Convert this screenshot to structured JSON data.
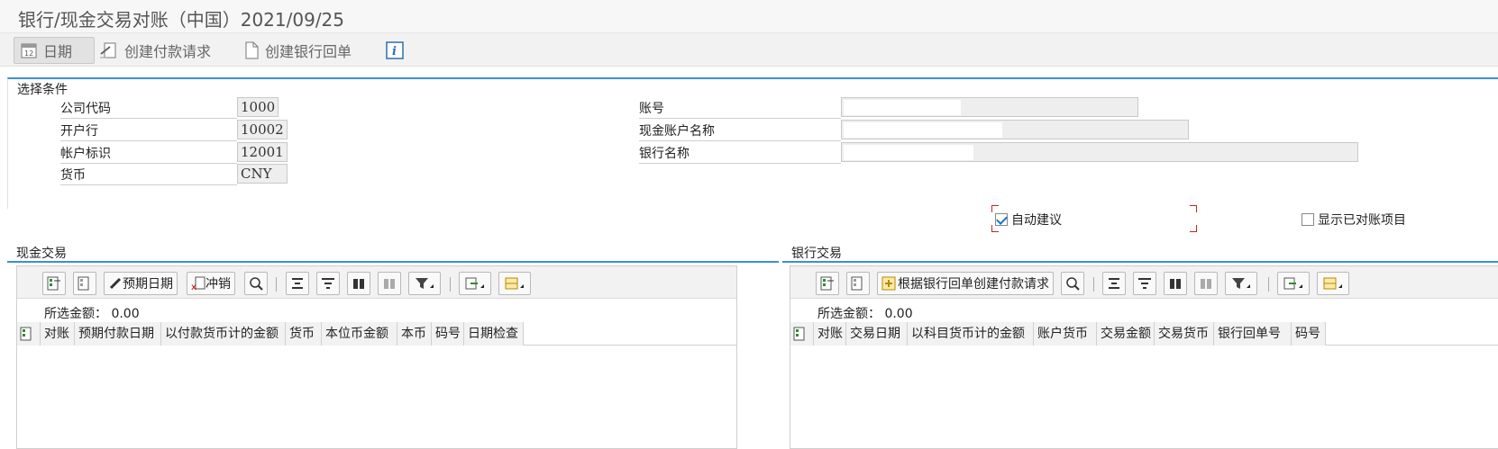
{
  "title": "银行/现金交易对账（中国）2021/09/25",
  "toolbar": {
    "date": "日期",
    "create_payment": "创建付款请求",
    "create_bank_receipt": "创建银行回单",
    "info": "i"
  },
  "selection": {
    "title": "选择条件",
    "left": [
      {
        "label": "公司代码",
        "value": "1000"
      },
      {
        "label": "开户行",
        "value": "10002"
      },
      {
        "label": "帐户标识",
        "value": "12001"
      },
      {
        "label": "货币",
        "value": "CNY"
      }
    ],
    "right": [
      {
        "label": "账号"
      },
      {
        "label": "现金账户名称"
      },
      {
        "label": "银行名称"
      }
    ]
  },
  "options": {
    "auto_suggest": {
      "label": "自动建议",
      "checked": true
    },
    "show_reconciled": {
      "label": "显示已对账项目",
      "checked": false
    }
  },
  "cash": {
    "title": "现金交易",
    "btn_expected_date": "预期日期",
    "btn_reverse": "冲销",
    "selected_amount_label": "所选金额：",
    "selected_amount": "0.00",
    "columns": [
      "对账",
      "预期付款日期",
      "以付款货币计的金额",
      "货币",
      "本位币金额",
      "本币",
      "码号",
      "日期检查"
    ]
  },
  "bank": {
    "title": "银行交易",
    "btn_create_from_receipt": "根据银行回单创建付款请求",
    "selected_amount_label": "所选金额：",
    "selected_amount": "0.00",
    "columns": [
      "对账",
      "交易日期",
      "以科目货币计的金额",
      "账户货币",
      "交易金额",
      "交易货币",
      "银行回单号",
      "码号"
    ]
  }
}
